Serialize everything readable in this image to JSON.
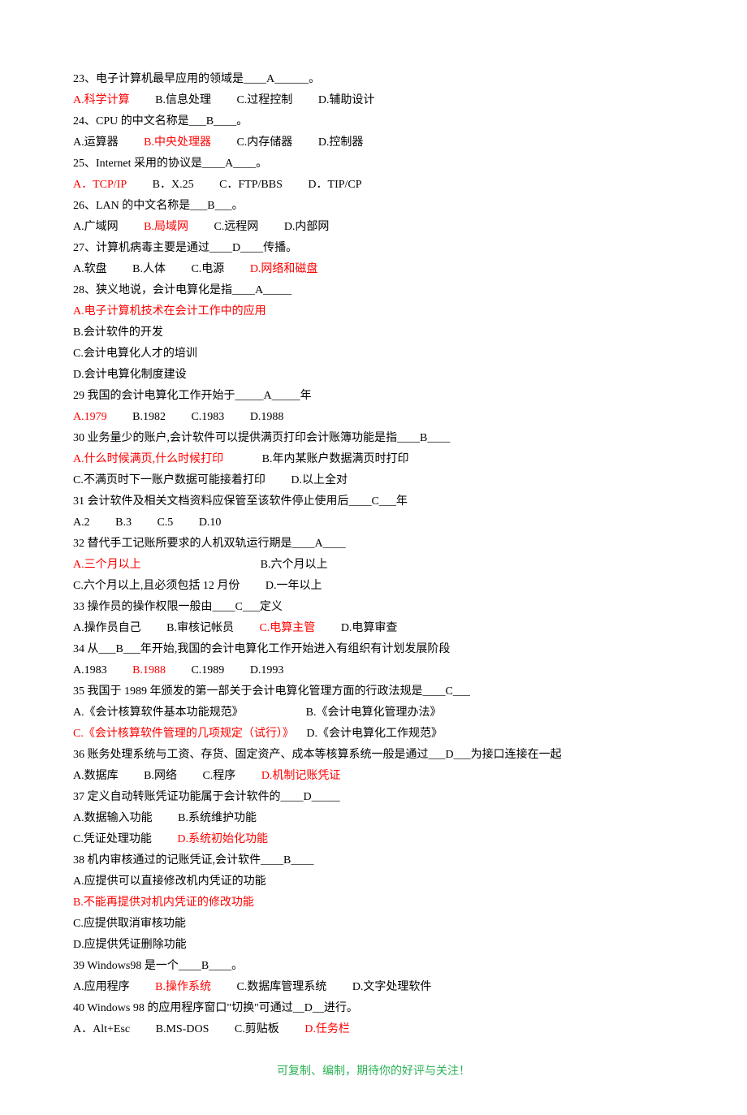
{
  "q23": {
    "stem": "23、电子计算机最早应用的领域是____A______。",
    "optA": "A.科学计算",
    "optB": "B.信息处理",
    "optC": "C.过程控制",
    "optD": "D.辅助设计"
  },
  "q24": {
    "stem": "24、CPU 的中文名称是___B____。",
    "optA": "A.运算器",
    "optB": "B.中央处理器",
    "optC": "C.内存储器",
    "optD": "D.控制器"
  },
  "q25": {
    "stem": "25、Internet 采用的协议是____A____。",
    "optA": "A．TCP/IP",
    "optB": "B．X.25",
    "optC": "C．FTP/BBS",
    "optD": "D．TIP/CP"
  },
  "q26": {
    "stem": "26、LAN 的中文名称是___B___。",
    "optA": "A.广域网",
    "optB": "B.局域网",
    "optC": "C.远程网",
    "optD": "D.内部网"
  },
  "q27": {
    "stem": "27、计算机病毒主要是通过____D____传播。",
    "optA": "A.软盘",
    "optB": "B.人体",
    "optC": "C.电源",
    "optD": "D.网络和磁盘"
  },
  "q28": {
    "stem": "28、狭义地说，会计电算化是指____A_____",
    "optA": "A.电子计算机技术在会计工作中的应用",
    "optB": "B.会计软件的开发",
    "optC": "C.会计电算化人才的培训",
    "optD": "D.会计电算化制度建设"
  },
  "q29": {
    "stem": "29 我国的会计电算化工作开始于_____A_____年",
    "optA": "A.1979",
    "optB": "B.1982",
    "optC": "C.1983",
    "optD": "D.1988"
  },
  "q30": {
    "stem": "30 业务量少的账户,会计软件可以提供满页打印会计账簿功能是指____B____",
    "optA": "A.什么时候满页,什么时候打印",
    "optB": "B.年内某账户数据满页时打印",
    "optC": "C.不满页时下一账户数据可能接着打印",
    "optD": "D.以上全对"
  },
  "q31": {
    "stem": "31 会计软件及相关文档资料应保管至该软件停止使用后____C___年",
    "optA": "A.2",
    "optB": "B.3",
    "optC": "C.5",
    "optD": "D.10"
  },
  "q32": {
    "stem": "32 替代手工记账所要求的人机双轨运行期是____A____",
    "optA": "A.三个月以上",
    "optB": "B.六个月以上",
    "optC": "C.六个月以上,且必须包括 12 月份",
    "optD": "D.一年以上"
  },
  "q33": {
    "stem": "33 操作员的操作权限一般由____C___定义",
    "optA": "A.操作员自己",
    "optB": "B.审核记帐员",
    "optC": "C.电算主管",
    "optD": "D.电算审查"
  },
  "q34": {
    "stem": "34 从___B___年开始,我国的会计电算化工作开始进入有组织有计划发展阶段",
    "optA": "A.1983",
    "optB": "B.1988",
    "optC": "C.1989",
    "optD": "D.1993"
  },
  "q35": {
    "stem": "35 我国于 1989 年颁发的第一部关于会计电算化管理方面的行政法规是____C___",
    "optA": "A.《会计核算软件基本功能规范》",
    "optB": "B.《会计电算化管理办法》",
    "optC": "C.《会计核算软件管理的几项规定（试行）》",
    "optD": "D.《会计电算化工作规范》"
  },
  "q36": {
    "stem": "36 账务处理系统与工资、存货、固定资产、成本等核算系统一般是通过___D___为接口连接在一起",
    "optA": "A.数据库",
    "optB": "B.网络",
    "optC": "C.程序",
    "optD": "D.机制记账凭证"
  },
  "q37": {
    "stem": "37 定义自动转账凭证功能属于会计软件的____D_____",
    "optA": "A.数据输入功能",
    "optB": "B.系统维护功能",
    "optC": "C.凭证处理功能",
    "optD": "D.系统初始化功能"
  },
  "q38": {
    "stem": "38 机内审核通过的记账凭证,会计软件____B____",
    "optA": "A.应提供可以直接修改机内凭证的功能",
    "optB": "B.不能再提供对机内凭证的修改功能",
    "optC": "C.应提供取消审核功能",
    "optD": "D.应提供凭证删除功能"
  },
  "q39": {
    "stem": "39 Windows98 是一个____B____。",
    "optA": "A.应用程序",
    "optB": "B.操作系统",
    "optC": "C.数据库管理系统",
    "optD": "D.文字处理软件"
  },
  "q40": {
    "stem": "40 Windows 98 的应用程序窗口\"切换\"可通过__D__进行。",
    "optA": "A．Alt+Esc",
    "optB": "B.MS-DOS",
    "optC": "C.剪贴板",
    "optD": "D.任务栏"
  },
  "footer": "可复制、编制，期待你的好评与关注！"
}
